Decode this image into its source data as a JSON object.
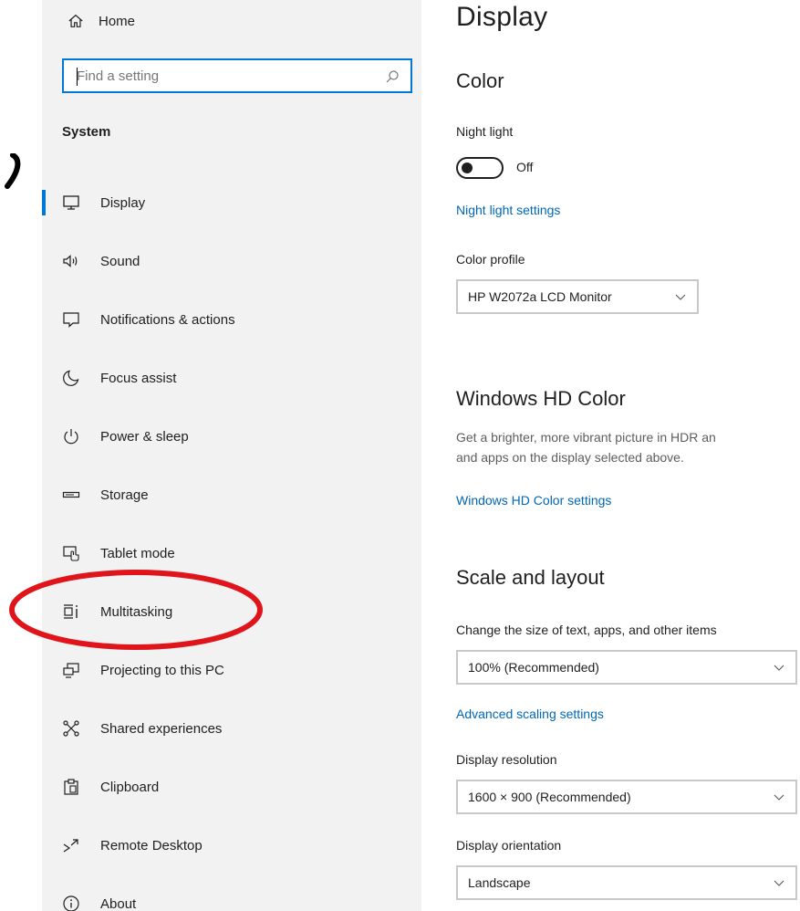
{
  "sidebar": {
    "home_label": "Home",
    "search_placeholder": "Find a setting",
    "section_title": "System",
    "items": [
      {
        "label": "Display",
        "icon": "monitor-icon",
        "active": true
      },
      {
        "label": "Sound",
        "icon": "speaker-icon"
      },
      {
        "label": "Notifications & actions",
        "icon": "notification-icon"
      },
      {
        "label": "Focus assist",
        "icon": "moon-icon"
      },
      {
        "label": "Power & sleep",
        "icon": "power-icon"
      },
      {
        "label": "Storage",
        "icon": "storage-icon"
      },
      {
        "label": "Tablet mode",
        "icon": "tablet-mode-icon"
      },
      {
        "label": "Multitasking",
        "icon": "multitasking-icon"
      },
      {
        "label": "Projecting to this PC",
        "icon": "projecting-icon"
      },
      {
        "label": "Shared experiences",
        "icon": "shared-experiences-icon"
      },
      {
        "label": "Clipboard",
        "icon": "clipboard-icon"
      },
      {
        "label": "Remote Desktop",
        "icon": "remote-desktop-icon"
      },
      {
        "label": "About",
        "icon": "info-icon"
      }
    ]
  },
  "main": {
    "title": "Display",
    "color": {
      "heading": "Color",
      "night_light_label": "Night light",
      "night_light_state": "Off",
      "night_light_settings_link": "Night light settings",
      "color_profile_label": "Color profile",
      "color_profile_value": "HP W2072a LCD Monitor"
    },
    "hd_color": {
      "heading": "Windows HD Color",
      "description_line1": "Get a brighter, more vibrant picture in HDR an",
      "description_line2": "and apps on the display selected above.",
      "settings_link": "Windows HD Color settings"
    },
    "scale": {
      "heading": "Scale and layout",
      "change_size_label": "Change the size of text, apps, and other items",
      "scale_value": "100% (Recommended)",
      "advanced_link": "Advanced scaling settings",
      "resolution_label": "Display resolution",
      "resolution_value": "1600 × 900 (Recommended)",
      "orientation_label": "Display orientation",
      "orientation_value": "Landscape"
    }
  },
  "colors": {
    "accent": "#0078d7",
    "link": "#0067b8",
    "sidebar_bg": "#f2f2f2",
    "highlight": "#e0151b"
  }
}
